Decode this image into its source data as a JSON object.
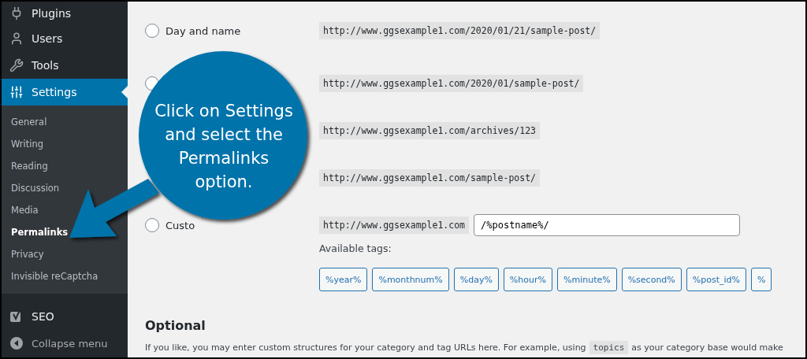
{
  "sidebar": {
    "menu": [
      {
        "label": "Plugins",
        "selected": false
      },
      {
        "label": "Users",
        "selected": false
      },
      {
        "label": "Tools",
        "selected": false
      },
      {
        "label": "Settings",
        "selected": true,
        "children": [
          {
            "label": "General",
            "selected": false
          },
          {
            "label": "Writing",
            "selected": false
          },
          {
            "label": "Reading",
            "selected": false
          },
          {
            "label": "Discussion",
            "selected": false
          },
          {
            "label": "Media",
            "selected": false
          },
          {
            "label": "Permalinks",
            "selected": true
          },
          {
            "label": "Privacy",
            "selected": false
          },
          {
            "label": "Invisible reCaptcha",
            "selected": false
          }
        ]
      },
      {
        "label": "SEO",
        "selected": false
      }
    ],
    "collapse": "Collapse menu"
  },
  "permalink_options": [
    {
      "label": "Day and name",
      "selected": false,
      "url": "http://www.ggsexample1.com/2020/01/21/sample-post/"
    },
    {
      "selected": false,
      "url": "http://www.ggsexample1.com/2020/01/sample-post/"
    },
    {
      "url": "http://www.ggsexample1.com/archives/123"
    },
    {
      "url": "http://www.ggsexample1.com/sample-post/"
    },
    {
      "label": "Custo",
      "selected": false,
      "url": "http://www.ggsexample1.com",
      "value": "/%postname%/"
    }
  ],
  "available_tags": {
    "label": "Available tags:",
    "tags": [
      "%year%",
      "%monthnum%",
      "%day%",
      "%hour%",
      "%minute%",
      "%second%",
      "%post_id%",
      "%"
    ]
  },
  "optional": {
    "heading": "Optional",
    "text_before": "If you like, you may enter custom structures for your category and tag URLs here. For example, using",
    "code": "topics",
    "text_after": "as your category base would make"
  },
  "callout": {
    "text": "Click on Settings and select the Permalinks option."
  }
}
